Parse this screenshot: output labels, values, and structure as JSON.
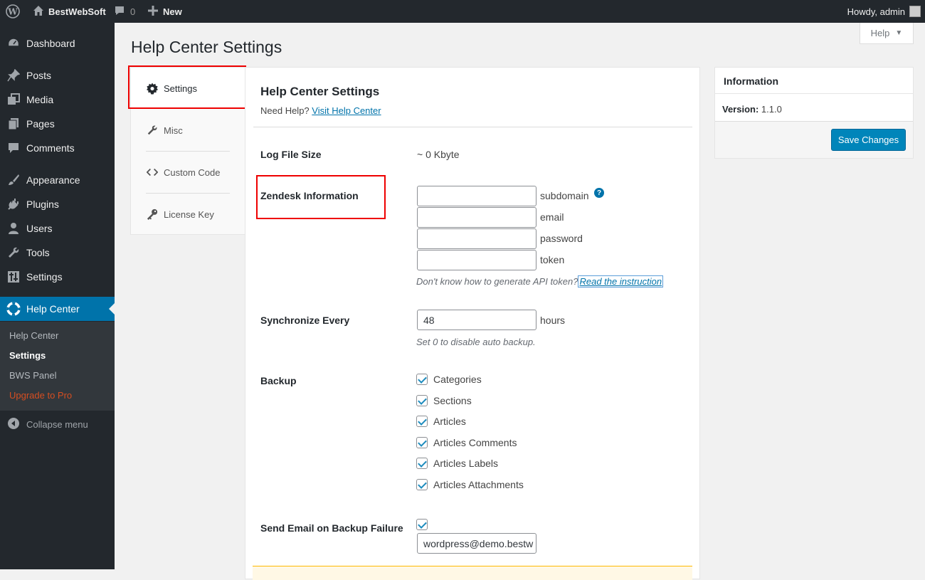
{
  "adminbar": {
    "site_name": "BestWebSoft",
    "comments_count": "0",
    "new_label": "New",
    "howdy": "Howdy, admin"
  },
  "sidebar": {
    "items": [
      {
        "label": "Dashboard",
        "icon": "dashboard-icon"
      },
      {
        "label": "Posts",
        "icon": "pin-icon"
      },
      {
        "label": "Media",
        "icon": "media-icon"
      },
      {
        "label": "Pages",
        "icon": "pages-icon"
      },
      {
        "label": "Comments",
        "icon": "comment-icon"
      },
      {
        "label": "Appearance",
        "icon": "brush-icon"
      },
      {
        "label": "Plugins",
        "icon": "plug-icon"
      },
      {
        "label": "Users",
        "icon": "user-icon"
      },
      {
        "label": "Tools",
        "icon": "wrench-icon"
      },
      {
        "label": "Settings",
        "icon": "settings-sliders-icon"
      },
      {
        "label": "Help Center",
        "icon": "lifebuoy-icon"
      }
    ],
    "submenu": [
      "Help Center",
      "Settings",
      "BWS Panel",
      "Upgrade to Pro"
    ],
    "collapse_label": "Collapse menu"
  },
  "help_tab": {
    "label": "Help"
  },
  "page_title": "Help Center Settings",
  "tabs": [
    {
      "label": "Settings",
      "icon": "gear-icon"
    },
    {
      "label": "Misc",
      "icon": "wrench-icon"
    },
    {
      "label": "Custom Code",
      "icon": "code-icon"
    },
    {
      "label": "License Key",
      "icon": "key-icon"
    }
  ],
  "main": {
    "title": "Help Center Settings",
    "need_help": "Need Help?",
    "visit_link": "Visit Help Center",
    "log_file_size": {
      "label": "Log File Size",
      "value": "~ 0 Kbyte"
    },
    "zendesk": {
      "label": "Zendesk Information",
      "fields": [
        {
          "value": "",
          "suffix": "subdomain"
        },
        {
          "value": "",
          "suffix": "email"
        },
        {
          "value": "",
          "suffix": "password"
        },
        {
          "value": "",
          "suffix": "token"
        }
      ],
      "hint": "Don't know how to generate API token?",
      "hint_link": "Read the instruction"
    },
    "sync": {
      "label": "Synchronize Every",
      "value": "48",
      "suffix": "hours",
      "hint": "Set 0 to disable auto backup."
    },
    "backup": {
      "label": "Backup",
      "options": [
        {
          "label": "Categories",
          "checked": true
        },
        {
          "label": "Sections",
          "checked": true
        },
        {
          "label": "Articles",
          "checked": true
        },
        {
          "label": "Articles Comments",
          "checked": true
        },
        {
          "label": "Articles Labels",
          "checked": true
        },
        {
          "label": "Articles Attachments",
          "checked": true
        }
      ]
    },
    "email_fail": {
      "label": "Send Email on Backup Failure",
      "checked": true,
      "value": "wordpress@demo.bestw"
    }
  },
  "info": {
    "title": "Information",
    "version_label": "Version:",
    "version_value": "1.1.0",
    "save_label": "Save Changes"
  },
  "colors": {
    "accent": "#0073aa",
    "sidebar_bg": "#23282d",
    "highlight_red": "#ee0000"
  }
}
